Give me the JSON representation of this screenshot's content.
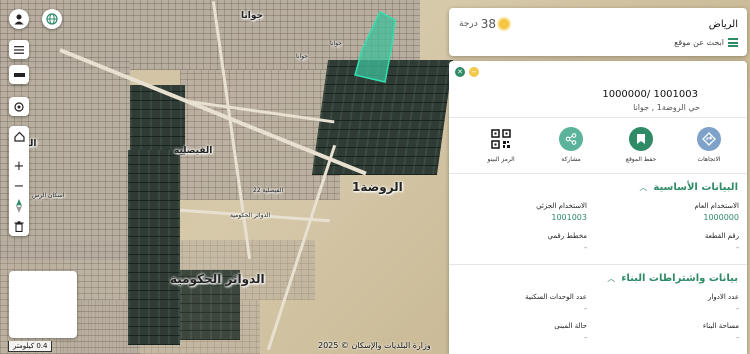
{
  "map": {
    "labels": {
      "jawana_top": "جوانا",
      "rawda1": "الروضة1",
      "faisaliya": "الفيصلية",
      "dawair": "الدوائر الحكومية",
      "jawana_side": "جوانا",
      "jawana_mid": "جوانا",
      "rass": "الرس",
      "iskan": "اسكان الرس",
      "street_a": "الدوائر الحكومية",
      "street_b": "الفيصلية 22"
    },
    "scale_label": "0.4 كيلومتر",
    "attribution": "وزارة البلديات والإسكان © 2025",
    "minimap_label": ""
  },
  "controls": {
    "profile_icon": "person-icon",
    "language_icon": "globe-icon",
    "layers_icon": "list-icon",
    "basemap_icon": "layers-icon",
    "locate_icon": "crosshair-icon",
    "home_icon": "home-icon",
    "zoom_in": "+",
    "zoom_out": "−",
    "north_icon": "compass-icon",
    "delete_icon": "trash-icon"
  },
  "top_panel": {
    "city": "الرياض",
    "temperature": "38",
    "temperature_unit": "درجة",
    "search_link": "ابحث عن موقع"
  },
  "info_panel": {
    "parcel_id": "1001003 /1000000",
    "parcel_location": "حي الروضة1 , جوانا",
    "actions": [
      {
        "label": "الاتجاهات",
        "icon": "directions-icon",
        "color": "#7ea2c9"
      },
      {
        "label": "حفظ الموقع",
        "icon": "bookmark-icon",
        "color": "#2e8b66"
      },
      {
        "label": "مشاركة",
        "icon": "share-icon",
        "color": "#5ab39a"
      },
      {
        "label": "الرمز البينو",
        "icon": "qr-icon",
        "color": "#ffffff"
      }
    ],
    "basic_data": {
      "title": "البيانات الأساسية",
      "general_use_label": "الاستخدام العام",
      "general_use_value": "1000000",
      "detailed_use_label": "الاستخدام الجزئي",
      "detailed_use_value": "1001003",
      "parcel_no_label": "رقم القطعة",
      "parcel_no_value": "-",
      "plan_label": "مخطط رقمي",
      "plan_value": "-"
    },
    "building_data": {
      "title": "بيانات واشتراطات البناء",
      "floors_label": "عدد الادوار",
      "floors_value": "-",
      "units_label": "عدد الوحدات السكنية",
      "units_value": "-",
      "area_label": "مساحة البناء",
      "area_value": "-",
      "condition_label": "حالة المبنى",
      "condition_value": "-"
    }
  },
  "colors": {
    "accent": "#2e8b66",
    "highlight": "#3fbf9a",
    "weather_sun": "#f4c542"
  }
}
